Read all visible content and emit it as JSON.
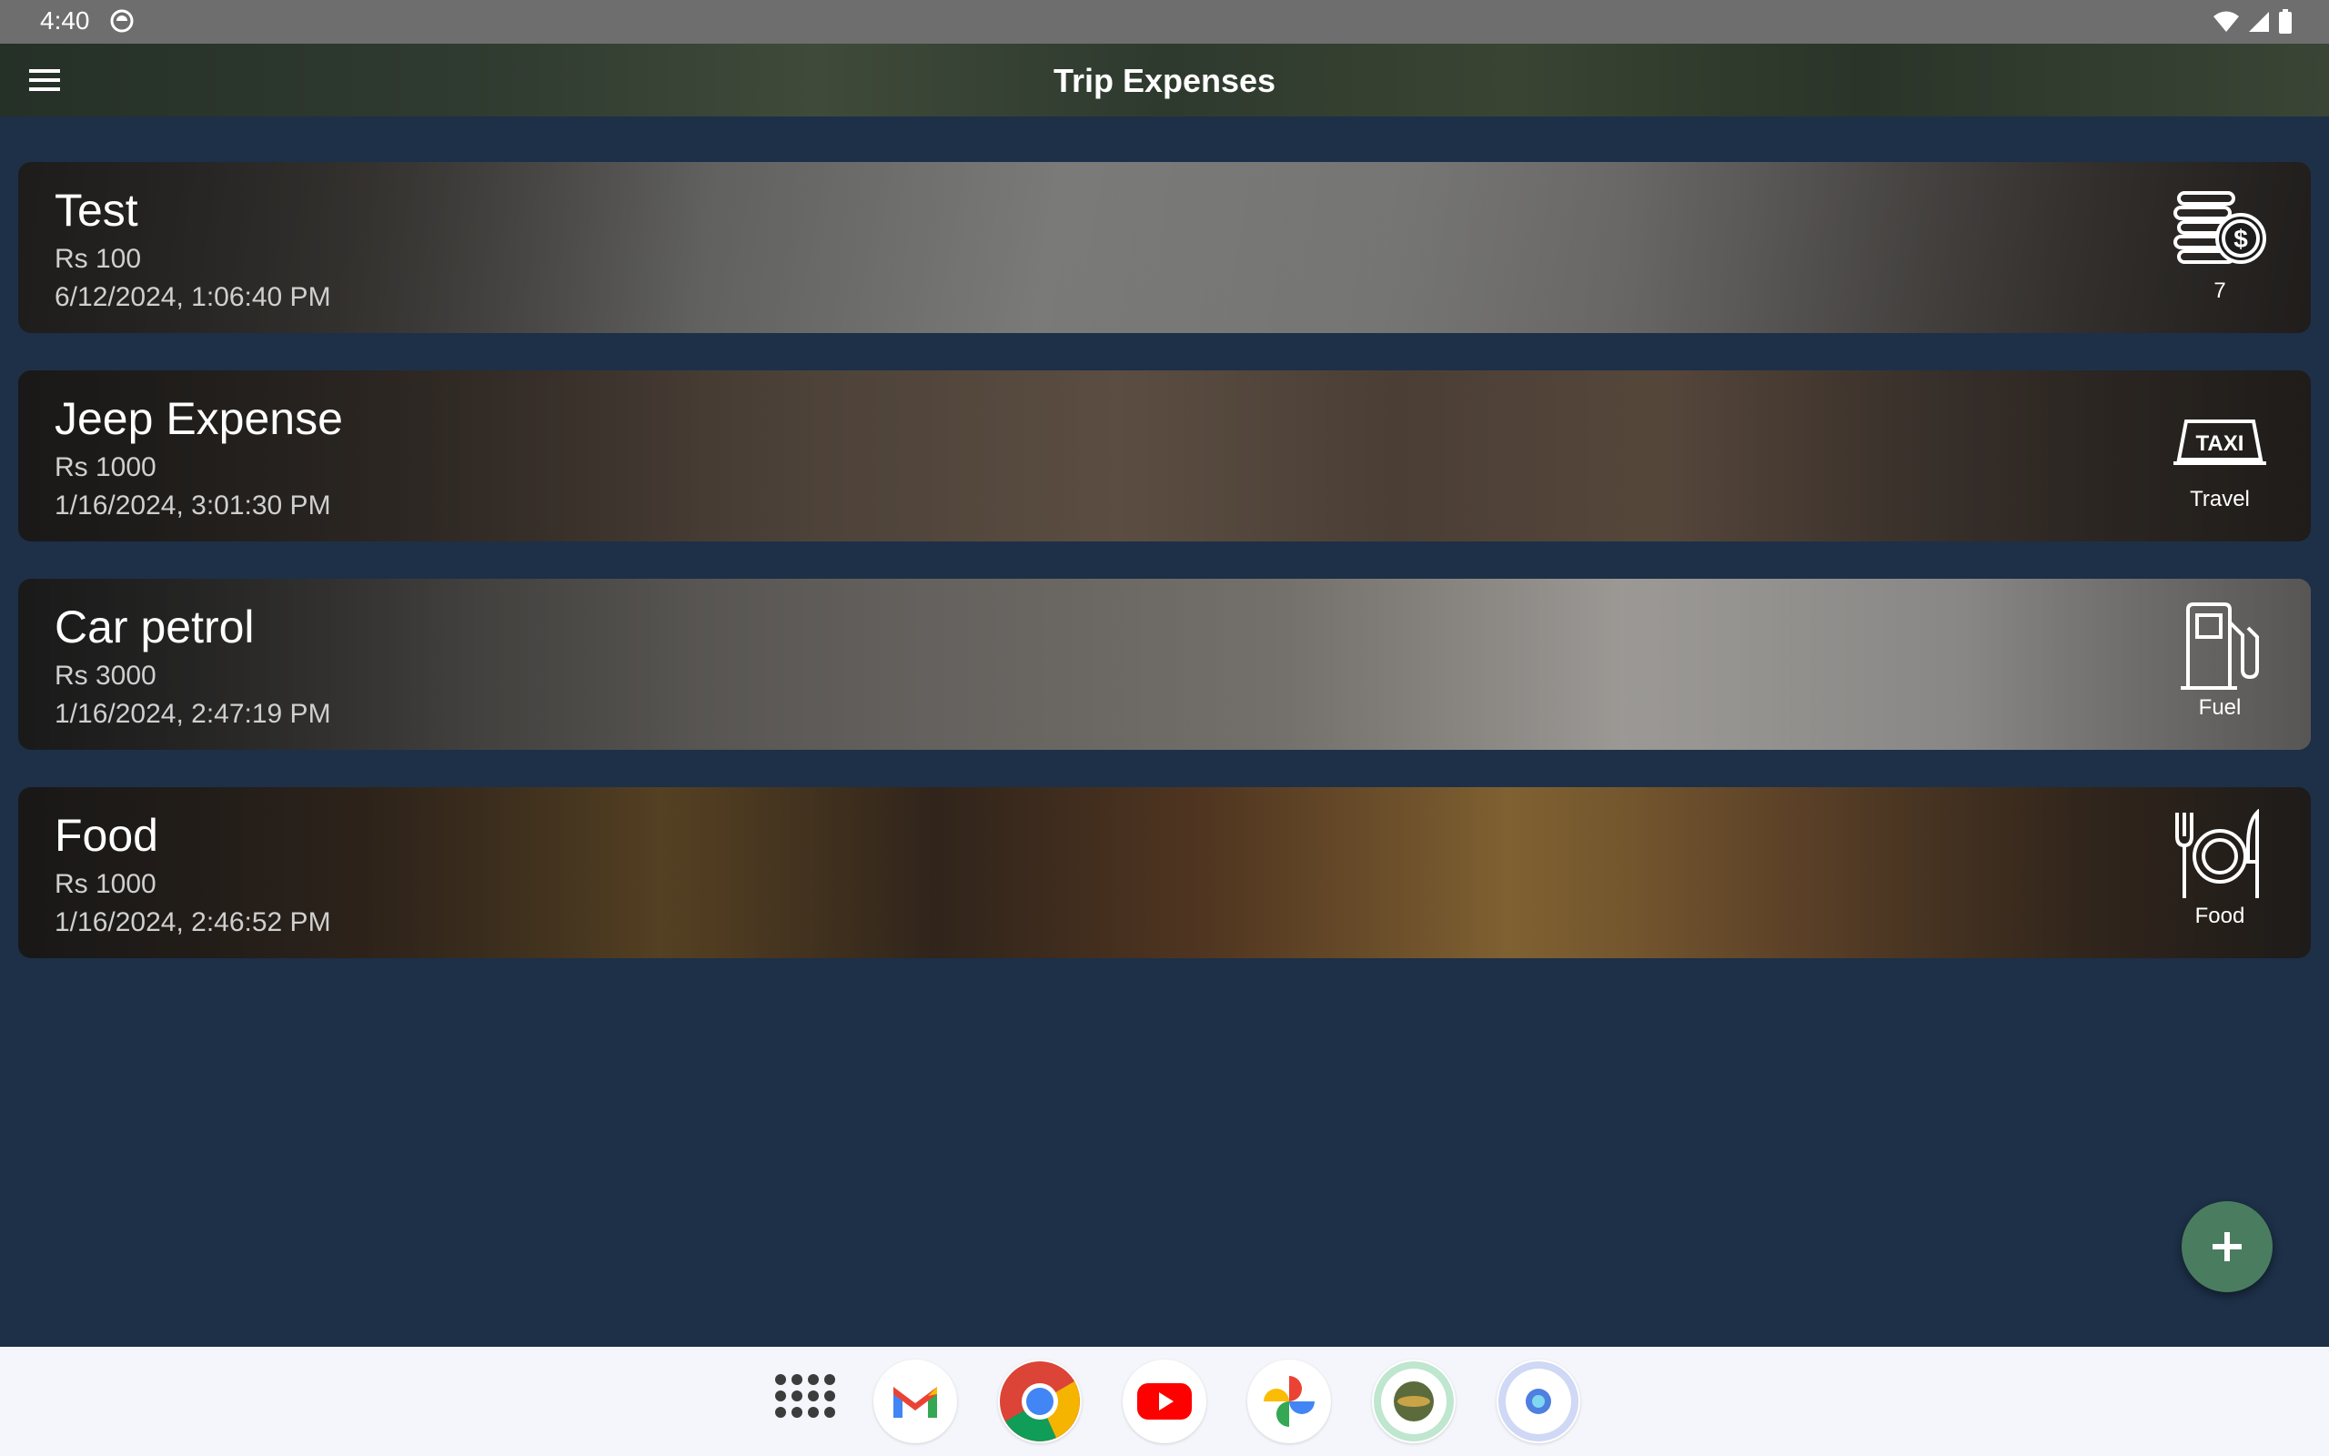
{
  "status_bar": {
    "time": "4:40",
    "icons": [
      "notification-icon",
      "wifi-icon",
      "signal-icon",
      "battery-icon"
    ]
  },
  "app_bar": {
    "title": "Trip Expenses",
    "menu_icon": "hamburger-menu-icon"
  },
  "expenses": [
    {
      "name": "Test",
      "amount": "Rs 100",
      "date": "6/12/2024, 1:06:40 PM",
      "category_label": "7",
      "category_icon": "coins-dollar-icon"
    },
    {
      "name": "Jeep Expense",
      "amount": "Rs 1000",
      "date": "1/16/2024, 3:01:30 PM",
      "category_label": "Travel",
      "category_icon": "taxi-sign-icon",
      "taxi_text": "TAXI"
    },
    {
      "name": "Car petrol",
      "amount": "Rs 3000",
      "date": "1/16/2024, 2:47:19 PM",
      "category_label": "Fuel",
      "category_icon": "fuel-pump-icon"
    },
    {
      "name": "Food",
      "amount": "Rs 1000",
      "date": "1/16/2024, 2:46:52 PM",
      "category_label": "Food",
      "category_icon": "plate-fork-knife-icon"
    }
  ],
  "fab": {
    "icon": "plus-icon",
    "color": "#4a7d60"
  },
  "dock": {
    "apps": [
      "app-drawer-icon",
      "gmail-icon",
      "chrome-icon",
      "youtube-icon",
      "photos-icon",
      "trip-app-icon",
      "camera-app-icon"
    ]
  },
  "colors": {
    "background": "#1d3048",
    "status_bar": "#6e6e6e",
    "dock": "#f4f6fb"
  }
}
